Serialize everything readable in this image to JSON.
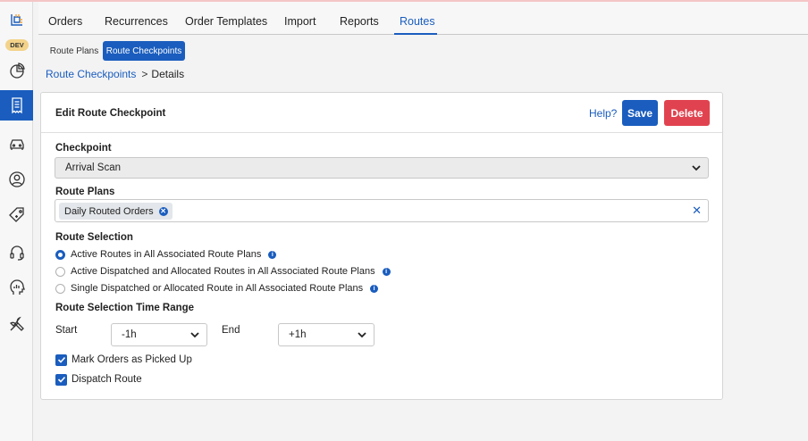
{
  "env_badge": "DEV",
  "sidebar": {
    "items": [
      {
        "icon": "logo-icon"
      },
      {
        "icon": "pie-chart-icon"
      },
      {
        "icon": "receipt-icon",
        "active": true
      },
      {
        "icon": "car-icon"
      },
      {
        "icon": "user-circle-icon"
      },
      {
        "icon": "price-tag-icon"
      },
      {
        "icon": "headset-icon"
      },
      {
        "icon": "analytics-head-icon"
      },
      {
        "icon": "tools-icon"
      }
    ]
  },
  "topnav": {
    "tabs": [
      "Orders",
      "Recurrences",
      "Order Templates",
      "Import",
      "Reports",
      "Routes"
    ],
    "active": "Routes"
  },
  "subtabs": {
    "items": [
      "Route Plans",
      "Route Checkpoints"
    ],
    "active": "Route Checkpoints"
  },
  "breadcrumb": {
    "link": "Route Checkpoints",
    "separator": ">",
    "current": "Details"
  },
  "card": {
    "title": "Edit Route Checkpoint",
    "help": "Help?",
    "save": "Save",
    "delete": "Delete"
  },
  "form": {
    "checkpoint_label": "Checkpoint",
    "checkpoint_value": "Arrival Scan",
    "route_plans_label": "Route Plans",
    "route_plans_chips": [
      "Daily Routed Orders"
    ],
    "route_selection_label": "Route Selection",
    "route_selection_options": [
      {
        "label": "Active Routes in All Associated Route Plans",
        "checked": true
      },
      {
        "label": "Active Dispatched and Allocated Routes in All Associated Route Plans",
        "checked": false
      },
      {
        "label": "Single Dispatched or Allocated Route in All Associated Route Plans",
        "checked": false
      }
    ],
    "time_range_label": "Route Selection Time Range",
    "start_label": "Start",
    "start_value": "-1h",
    "end_label": "End",
    "end_value": "+1h",
    "mark_picked_up_label": "Mark Orders as Picked Up",
    "mark_picked_up_checked": true,
    "dispatch_route_label": "Dispatch Route",
    "dispatch_route_checked": true
  },
  "colors": {
    "primary": "#1a5dbe",
    "danger": "#e0434f",
    "badge": "#f3d38a"
  }
}
